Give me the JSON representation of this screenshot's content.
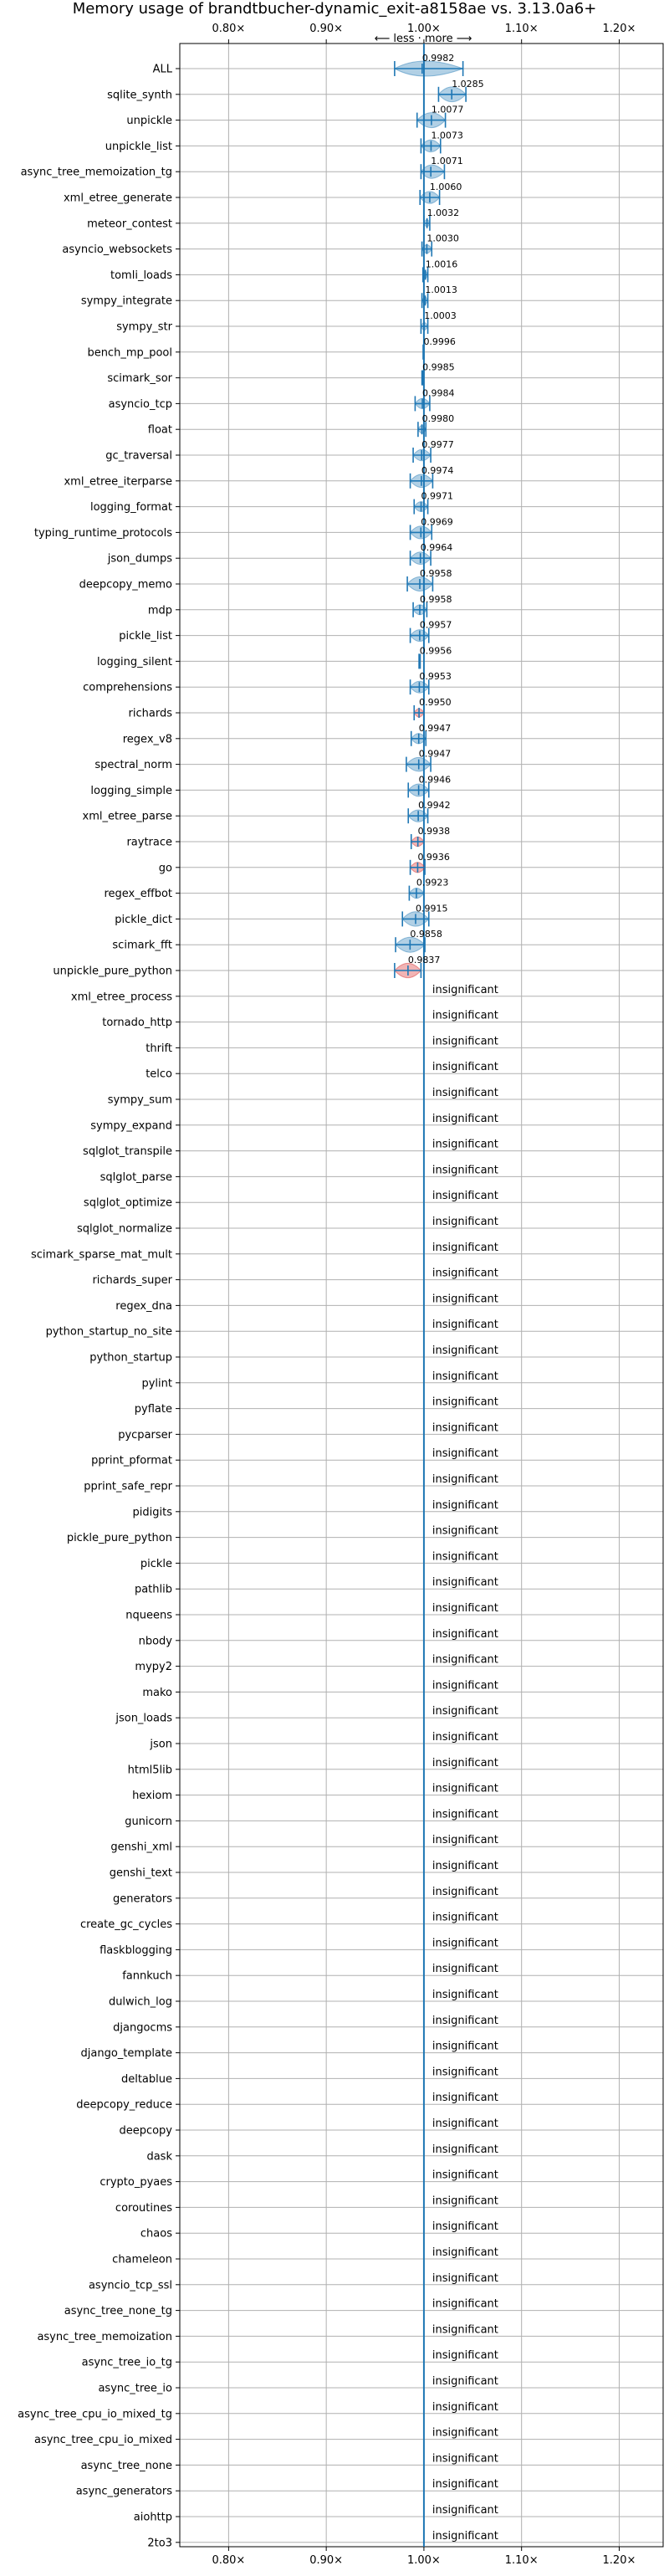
{
  "chart_data": {
    "type": "violin",
    "title": "Memory usage of brandtbucher-dynamic_exit-a8158ae vs. 3.13.0a6+",
    "direction_hint": "⟵ less · more ⟶",
    "xlabel": "",
    "ylabel": "",
    "xlim": [
      0.75,
      1.245
    ],
    "x_ticks": [
      0.8,
      0.9,
      1.0,
      1.1,
      1.2
    ],
    "x_tick_labels": [
      "0.80×",
      "0.90×",
      "1.00×",
      "1.10×",
      "1.20×"
    ],
    "reference_line": 1.0,
    "grid": true,
    "colors": {
      "normal": "#1f77b4",
      "highlight": "#d62728",
      "grid": "#b0b0b0"
    },
    "insignificant_label": "insignificant",
    "benchmarks": [
      {
        "name": "ALL",
        "value": 0.9982,
        "label": "0.9982",
        "low": 0.97,
        "high": 1.04,
        "color": "normal"
      },
      {
        "name": "sqlite_synth",
        "value": 1.0285,
        "label": "1.0285",
        "low": 1.015,
        "high": 1.043,
        "color": "normal"
      },
      {
        "name": "unpickle",
        "value": 1.0077,
        "label": "1.0077",
        "low": 0.993,
        "high": 1.022,
        "color": "normal"
      },
      {
        "name": "unpickle_list",
        "value": 1.0073,
        "label": "1.0073",
        "low": 0.997,
        "high": 1.017,
        "color": "normal"
      },
      {
        "name": "async_tree_memoization_tg",
        "value": 1.0071,
        "label": "1.0071",
        "low": 0.997,
        "high": 1.021,
        "color": "normal"
      },
      {
        "name": "xml_etree_generate",
        "value": 1.006,
        "label": "1.0060",
        "low": 0.996,
        "high": 1.016,
        "color": "normal"
      },
      {
        "name": "meteor_contest",
        "value": 1.0032,
        "label": "1.0032",
        "low": 1.0,
        "high": 1.006,
        "color": "normal"
      },
      {
        "name": "asyncio_websockets",
        "value": 1.003,
        "label": "1.0030",
        "low": 0.998,
        "high": 1.008,
        "color": "normal"
      },
      {
        "name": "tomli_loads",
        "value": 1.0016,
        "label": "1.0016",
        "low": 0.999,
        "high": 1.004,
        "color": "normal"
      },
      {
        "name": "sympy_integrate",
        "value": 1.0013,
        "label": "1.0013",
        "low": 0.998,
        "high": 1.004,
        "color": "normal"
      },
      {
        "name": "sympy_str",
        "value": 1.0003,
        "label": "1.0003",
        "low": 0.997,
        "high": 1.004,
        "color": "normal"
      },
      {
        "name": "bench_mp_pool",
        "value": 0.9996,
        "label": "0.9996",
        "low": 0.9992,
        "high": 1.0,
        "color": "normal"
      },
      {
        "name": "scimark_sor",
        "value": 0.9985,
        "label": "0.9985",
        "low": 0.998,
        "high": 0.999,
        "color": "normal"
      },
      {
        "name": "asyncio_tcp",
        "value": 0.9984,
        "label": "0.9984",
        "low": 0.991,
        "high": 1.006,
        "color": "normal"
      },
      {
        "name": "float",
        "value": 0.998,
        "label": "0.9980",
        "low": 0.994,
        "high": 1.002,
        "color": "normal"
      },
      {
        "name": "gc_traversal",
        "value": 0.9977,
        "label": "0.9977",
        "low": 0.989,
        "high": 1.007,
        "color": "normal"
      },
      {
        "name": "xml_etree_iterparse",
        "value": 0.9974,
        "label": "0.9974",
        "low": 0.986,
        "high": 1.009,
        "color": "normal"
      },
      {
        "name": "logging_format",
        "value": 0.9971,
        "label": "0.9971",
        "low": 0.99,
        "high": 1.004,
        "color": "normal"
      },
      {
        "name": "typing_runtime_protocols",
        "value": 0.9969,
        "label": "0.9969",
        "low": 0.986,
        "high": 1.008,
        "color": "normal"
      },
      {
        "name": "json_dumps",
        "value": 0.9964,
        "label": "0.9964",
        "low": 0.986,
        "high": 1.007,
        "color": "normal"
      },
      {
        "name": "deepcopy_memo",
        "value": 0.9958,
        "label": "0.9958",
        "low": 0.983,
        "high": 1.009,
        "color": "normal"
      },
      {
        "name": "mdp",
        "value": 0.9958,
        "label": "0.9958",
        "low": 0.989,
        "high": 1.003,
        "color": "normal"
      },
      {
        "name": "pickle_list",
        "value": 0.9957,
        "label": "0.9957",
        "low": 0.986,
        "high": 1.005,
        "color": "normal"
      },
      {
        "name": "logging_silent",
        "value": 0.9956,
        "label": "0.9956",
        "low": 0.995,
        "high": 0.9962,
        "color": "normal"
      },
      {
        "name": "comprehensions",
        "value": 0.9953,
        "label": "0.9953",
        "low": 0.986,
        "high": 1.005,
        "color": "normal"
      },
      {
        "name": "richards",
        "value": 0.995,
        "label": "0.9950",
        "low": 0.99,
        "high": 1.0,
        "color": "highlight"
      },
      {
        "name": "regex_v8",
        "value": 0.9947,
        "label": "0.9947",
        "low": 0.987,
        "high": 1.002,
        "color": "normal"
      },
      {
        "name": "spectral_norm",
        "value": 0.9947,
        "label": "0.9947",
        "low": 0.982,
        "high": 1.007,
        "color": "normal"
      },
      {
        "name": "logging_simple",
        "value": 0.9946,
        "label": "0.9946",
        "low": 0.984,
        "high": 1.005,
        "color": "normal"
      },
      {
        "name": "xml_etree_parse",
        "value": 0.9942,
        "label": "0.9942",
        "low": 0.984,
        "high": 1.004,
        "color": "normal"
      },
      {
        "name": "raytrace",
        "value": 0.9938,
        "label": "0.9938",
        "low": 0.987,
        "high": 1.0,
        "color": "highlight"
      },
      {
        "name": "go",
        "value": 0.9936,
        "label": "0.9936",
        "low": 0.986,
        "high": 1.001,
        "color": "highlight"
      },
      {
        "name": "regex_effbot",
        "value": 0.9923,
        "label": "0.9923",
        "low": 0.985,
        "high": 1.0,
        "color": "normal"
      },
      {
        "name": "pickle_dict",
        "value": 0.9915,
        "label": "0.9915",
        "low": 0.978,
        "high": 1.005,
        "color": "normal"
      },
      {
        "name": "scimark_fft",
        "value": 0.9858,
        "label": "0.9858",
        "low": 0.971,
        "high": 1.001,
        "color": "normal"
      },
      {
        "name": "unpickle_pure_python",
        "value": 0.9837,
        "label": "0.9837",
        "low": 0.97,
        "high": 0.997,
        "color": "highlight"
      },
      {
        "name": "xml_etree_process",
        "insignificant": true
      },
      {
        "name": "tornado_http",
        "insignificant": true
      },
      {
        "name": "thrift",
        "insignificant": true
      },
      {
        "name": "telco",
        "insignificant": true
      },
      {
        "name": "sympy_sum",
        "insignificant": true
      },
      {
        "name": "sympy_expand",
        "insignificant": true
      },
      {
        "name": "sqlglot_transpile",
        "insignificant": true
      },
      {
        "name": "sqlglot_parse",
        "insignificant": true
      },
      {
        "name": "sqlglot_optimize",
        "insignificant": true
      },
      {
        "name": "sqlglot_normalize",
        "insignificant": true
      },
      {
        "name": "scimark_sparse_mat_mult",
        "insignificant": true
      },
      {
        "name": "richards_super",
        "insignificant": true
      },
      {
        "name": "regex_dna",
        "insignificant": true
      },
      {
        "name": "python_startup_no_site",
        "insignificant": true
      },
      {
        "name": "python_startup",
        "insignificant": true
      },
      {
        "name": "pylint",
        "insignificant": true
      },
      {
        "name": "pyflate",
        "insignificant": true
      },
      {
        "name": "pycparser",
        "insignificant": true
      },
      {
        "name": "pprint_pformat",
        "insignificant": true
      },
      {
        "name": "pprint_safe_repr",
        "insignificant": true
      },
      {
        "name": "pidigits",
        "insignificant": true
      },
      {
        "name": "pickle_pure_python",
        "insignificant": true
      },
      {
        "name": "pickle",
        "insignificant": true
      },
      {
        "name": "pathlib",
        "insignificant": true
      },
      {
        "name": "nqueens",
        "insignificant": true
      },
      {
        "name": "nbody",
        "insignificant": true
      },
      {
        "name": "mypy2",
        "insignificant": true
      },
      {
        "name": "mako",
        "insignificant": true
      },
      {
        "name": "json_loads",
        "insignificant": true
      },
      {
        "name": "json",
        "insignificant": true
      },
      {
        "name": "html5lib",
        "insignificant": true
      },
      {
        "name": "hexiom",
        "insignificant": true
      },
      {
        "name": "gunicorn",
        "insignificant": true
      },
      {
        "name": "genshi_xml",
        "insignificant": true
      },
      {
        "name": "genshi_text",
        "insignificant": true
      },
      {
        "name": "generators",
        "insignificant": true
      },
      {
        "name": "create_gc_cycles",
        "insignificant": true
      },
      {
        "name": "flaskblogging",
        "insignificant": true
      },
      {
        "name": "fannkuch",
        "insignificant": true
      },
      {
        "name": "dulwich_log",
        "insignificant": true
      },
      {
        "name": "djangocms",
        "insignificant": true
      },
      {
        "name": "django_template",
        "insignificant": true
      },
      {
        "name": "deltablue",
        "insignificant": true
      },
      {
        "name": "deepcopy_reduce",
        "insignificant": true
      },
      {
        "name": "deepcopy",
        "insignificant": true
      },
      {
        "name": "dask",
        "insignificant": true
      },
      {
        "name": "crypto_pyaes",
        "insignificant": true
      },
      {
        "name": "coroutines",
        "insignificant": true
      },
      {
        "name": "chaos",
        "insignificant": true
      },
      {
        "name": "chameleon",
        "insignificant": true
      },
      {
        "name": "asyncio_tcp_ssl",
        "insignificant": true
      },
      {
        "name": "async_tree_none_tg",
        "insignificant": true
      },
      {
        "name": "async_tree_memoization",
        "insignificant": true
      },
      {
        "name": "async_tree_io_tg",
        "insignificant": true
      },
      {
        "name": "async_tree_io",
        "insignificant": true
      },
      {
        "name": "async_tree_cpu_io_mixed_tg",
        "insignificant": true
      },
      {
        "name": "async_tree_cpu_io_mixed",
        "insignificant": true
      },
      {
        "name": "async_tree_none",
        "insignificant": true
      },
      {
        "name": "async_generators",
        "insignificant": true
      },
      {
        "name": "aiohttp",
        "insignificant": true
      },
      {
        "name": "2to3",
        "insignificant": true
      }
    ]
  }
}
